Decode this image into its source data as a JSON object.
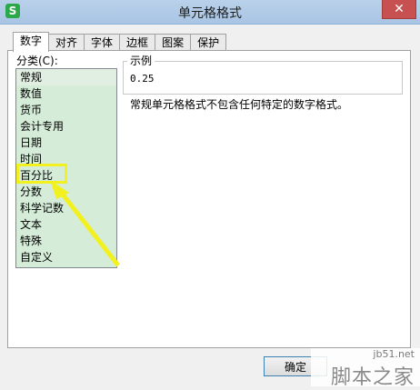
{
  "window": {
    "title": "单元格格式",
    "app_icon": "S",
    "close_glyph": "✕"
  },
  "tabs": [
    {
      "label": "数字",
      "active": true
    },
    {
      "label": "对齐"
    },
    {
      "label": "字体"
    },
    {
      "label": "边框"
    },
    {
      "label": "图案"
    },
    {
      "label": "保护"
    }
  ],
  "category": {
    "label": "分类(C):",
    "items": [
      "常规",
      "数值",
      "货币",
      "会计专用",
      "日期",
      "时间",
      "百分比",
      "分数",
      "科学记数",
      "文本",
      "特殊",
      "自定义"
    ],
    "selected_index": 0,
    "highlighted_item": "百分比"
  },
  "sample": {
    "legend": "示例",
    "value": "0.25"
  },
  "description": "常规单元格格式不包含任何特定的数字格式。",
  "buttons": {
    "ok": "确定"
  },
  "watermark": {
    "site": "jb51.net",
    "brand": "脚本之家"
  },
  "colors": {
    "annotation": "#f3f020",
    "list_bg": "#d5edd8"
  }
}
